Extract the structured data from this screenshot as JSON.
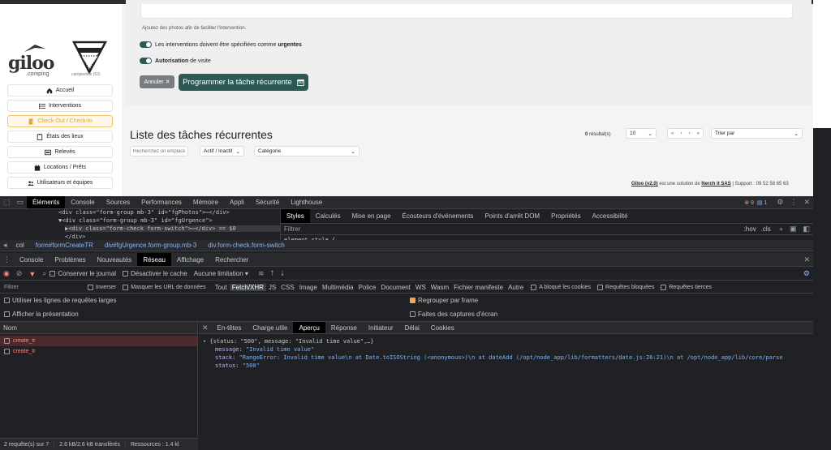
{
  "app": {
    "logo_text": "giloo",
    "logo_sub": ".comping",
    "campsite_name": "campiestok (52)",
    "nav": [
      {
        "label": "Accueil",
        "icon": "home-icon"
      },
      {
        "label": "Interventions",
        "icon": "list-icon"
      },
      {
        "label": "Check-Out / Check-In",
        "icon": "door-icon",
        "active": true
      },
      {
        "label": "États des lieux",
        "icon": "clipboard-icon"
      },
      {
        "label": "Relevés",
        "icon": "meter-icon"
      },
      {
        "label": "Locations / Prêts",
        "icon": "calendar-icon"
      },
      {
        "label": "Utilisateurs et équipes",
        "icon": "users-icon"
      }
    ],
    "form": {
      "hint": "Ajoutez des photos afin de faciliter l'intervention.",
      "toggle1_pre": "Les interventions doivent être spécifiées comme ",
      "toggle1_bold": "urgentes",
      "toggle2_bold": "Autorisation",
      "toggle2_post": " de visite",
      "cancel_label": "Annuler",
      "submit_label": "Programmer la tâche récurrente"
    },
    "list": {
      "title": "Liste des tâches récurrentes",
      "results_count": "0",
      "results_label": " résultat(s)",
      "per_page": "10",
      "sort_placeholder": "Trier par",
      "search_placeholder": "Recherchez un emplace",
      "filter_active": "Actif / Inactif",
      "filter_category": "Catégorie"
    },
    "footer": {
      "brand": "Giloo (v2.0)",
      "mid": " est une solution de ",
      "company": "Nerch it SAS",
      "support": " | Support : 09 52 58 65 63"
    }
  },
  "devtools": {
    "top_tabs": [
      "Éléments",
      "Console",
      "Sources",
      "Performances",
      "Mémoire",
      "Appli",
      "Sécurité",
      "Lighthouse"
    ],
    "errors": "9",
    "messages": "1",
    "dom_lines": [
      {
        "text": "<div class=\"form-group mb-3\" id=\"fgPhotos\">⋯</div>"
      },
      {
        "text": "▼<div class=\"form-group mb-3\" id=\"fgUrgence\">"
      },
      {
        "text": "▶<div class=\"form-check form-switch\">⋯</div> == $0"
      },
      {
        "text": "</div>"
      }
    ],
    "styles_tabs": [
      "Styles",
      "Calculés",
      "Mise en page",
      "Écouteurs d'événements",
      "Points d'arrêt DOM",
      "Propriétés",
      "Accessibilité"
    ],
    "styles_filter": "Filtrer",
    "styles_hov": ":hov",
    "styles_cls": ".cls",
    "element_style": "element.style {",
    "breadcrumb": [
      "col",
      "form#formCreateTR",
      "div#fgUrgence.form-group.mb-3",
      "div.form-check.form-switch"
    ],
    "drawer_tabs": [
      "Console",
      "Problèmes",
      "Nouveautés",
      "Réseau",
      "Affichage",
      "Rechercher"
    ],
    "preserve_log": "Conserver le journal",
    "disable_cache": "Désactiver le cache",
    "throttle": "Aucune limitation",
    "filter_placeholder": "Filtrer",
    "invert": "Inverser",
    "hide_urls": "Masquer les URL de données",
    "types": [
      "Tout",
      "Fetch/XHR",
      "JS",
      "CSS",
      "Image",
      "Multimédia",
      "Police",
      "Document",
      "WS",
      "Wasm",
      "Fichier manifeste",
      "Autre"
    ],
    "blocked_cookies": "A bloqué les cookies",
    "blocked_requests": "Requêtes bloquées",
    "third_party": "Requêtes tierces",
    "large_rows": "Utiliser les lignes de requêtes larges",
    "group_frame": "Regrouper par frame",
    "overview": "Afficher la présentation",
    "screenshots": "Faites des captures d'écran",
    "col_name": "Nom",
    "requests": [
      "create_tr",
      "create_tr"
    ],
    "detail_tabs": [
      "En-têtes",
      "Charge utile",
      "Aperçu",
      "Réponse",
      "Initiateur",
      "Délai",
      "Cookies"
    ],
    "preview": {
      "summary": "{status: \"500\", message: \"Invalid time value\",…}",
      "message_key": "message",
      "message_val": "\"Invalid time value\"",
      "stack_key": "stack",
      "stack_val": "\"RangeError: Invalid time value\\n    at Date.toISOString (<anonymous>)\\n    at dateAdd (/opt/node_app/lib/formatters/date.js:26:21)\\n    at /opt/node_app/lib/core/parse",
      "status_key": "status",
      "status_val": "\"500\""
    },
    "status_bar": {
      "requests": "2 requête(s) sur 7",
      "transferred": "2.6 kB/2.6 kB transférés",
      "resources": "Ressources : 1.4 kl"
    }
  }
}
